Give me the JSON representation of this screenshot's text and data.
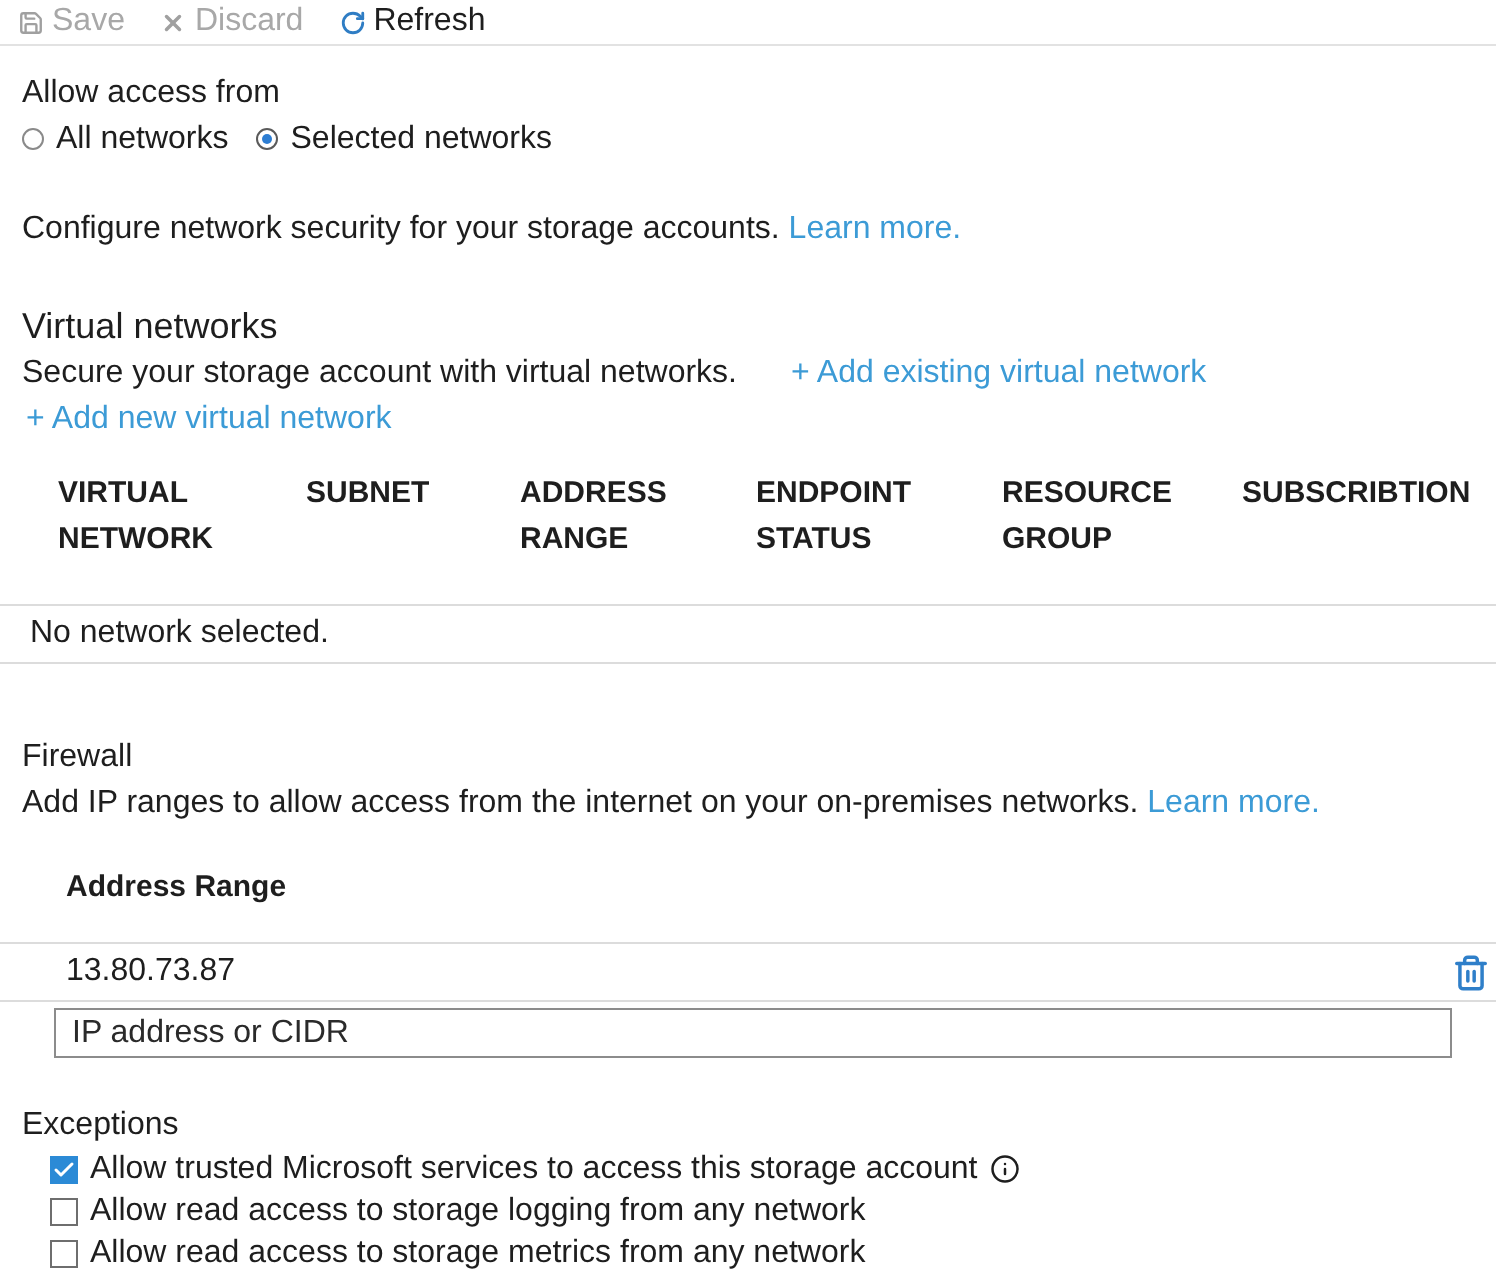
{
  "toolbar": {
    "buttons": [
      {
        "kind": "save",
        "label": "Save",
        "disabled": true
      },
      {
        "kind": "discard",
        "label": "Discard",
        "disabled": true
      },
      {
        "kind": "refresh",
        "label": "Refresh",
        "disabled": false
      }
    ]
  },
  "access": {
    "label": "Allow access from",
    "options": [
      {
        "label": "All networks",
        "selected": false
      },
      {
        "label": "Selected networks",
        "selected": true
      }
    ]
  },
  "intro": {
    "text": "Configure network security for your storage accounts.",
    "link": "Learn more."
  },
  "virtual_networks": {
    "title": "Virtual networks",
    "description": "Secure your storage account with virtual networks.",
    "add_existing_link": "+ Add existing virtual network",
    "add_new_link": "+ Add new virtual network",
    "table": {
      "columns": [
        "VIRTUAL NETWORK",
        "SUBNET",
        "ADDRESS RANGE",
        "ENDPOINT STATUS",
        "RESOURCE GROUP",
        "SUBSCRIBTION"
      ],
      "empty_message": "No network selected."
    }
  },
  "firewall": {
    "title": "Firewall",
    "description": "Add IP ranges to allow access from the internet on your on-premises networks.",
    "link": "Learn more.",
    "table": {
      "columns": [
        "Address Range"
      ],
      "rows": [
        {
          "address": "13.80.73.87"
        }
      ],
      "new_entry": {
        "placeholder": "IP address or CIDR"
      }
    }
  },
  "exceptions": {
    "title": "Exceptions",
    "items": [
      {
        "label": "Allow trusted Microsoft services to access this storage account",
        "checked": true,
        "info": true
      },
      {
        "label": "Allow read access to storage logging from any network",
        "checked": false,
        "info": false
      },
      {
        "label": "Allow read access to storage metrics from any network",
        "checked": false,
        "info": false
      }
    ]
  }
}
